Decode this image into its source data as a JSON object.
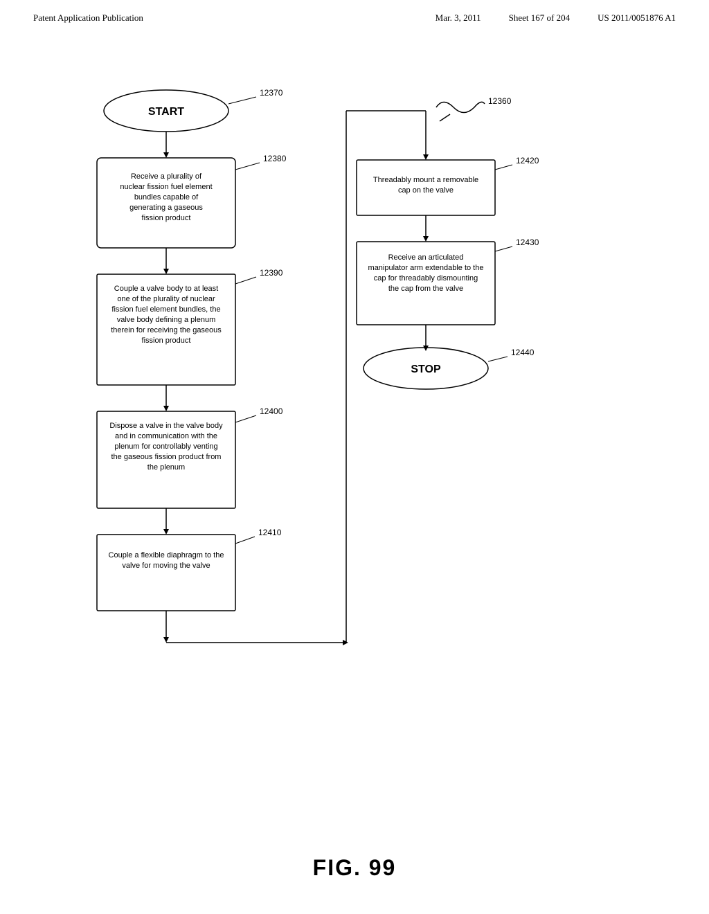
{
  "header": {
    "left": "Patent Application Publication",
    "date": "Mar. 3, 2011",
    "sheet": "Sheet 167 of 204",
    "patent": "US 2011/0051876 A1"
  },
  "fig_label": "FIG. 99",
  "flowchart": {
    "nodes": {
      "start": {
        "id": "12370",
        "label": "START",
        "type": "terminal"
      },
      "n12380": {
        "id": "12380",
        "label": "Receive a plurality of nuclear fission fuel element bundles capable of generating a gaseous fission product",
        "type": "process"
      },
      "n12390": {
        "id": "12390",
        "label": "Couple a valve body to at least one of the plurality of nuclear fission fuel element bundles, the valve body defining a plenum therein for receiving the gaseous fission product",
        "type": "process"
      },
      "n12400": {
        "id": "12400",
        "label": "Dispose a valve in the valve body and in communication with the plenum for controllably venting the gaseous fission product from the plenum",
        "type": "process"
      },
      "n12410": {
        "id": "12410",
        "label": "Couple a flexible diaphragm to the valve for moving the valve",
        "type": "process"
      },
      "n12420": {
        "id": "12420",
        "label": "Threadably mount a removable cap on the valve",
        "type": "process"
      },
      "n12430": {
        "id": "12430",
        "label": "Receive an articulated manipulator arm extendable to the cap for threadably dismounting the cap from the valve",
        "type": "process"
      },
      "stop": {
        "id": "12440",
        "label": "STOP",
        "type": "terminal"
      },
      "n12360": {
        "id": "12360",
        "label": "",
        "type": "connector"
      }
    }
  }
}
